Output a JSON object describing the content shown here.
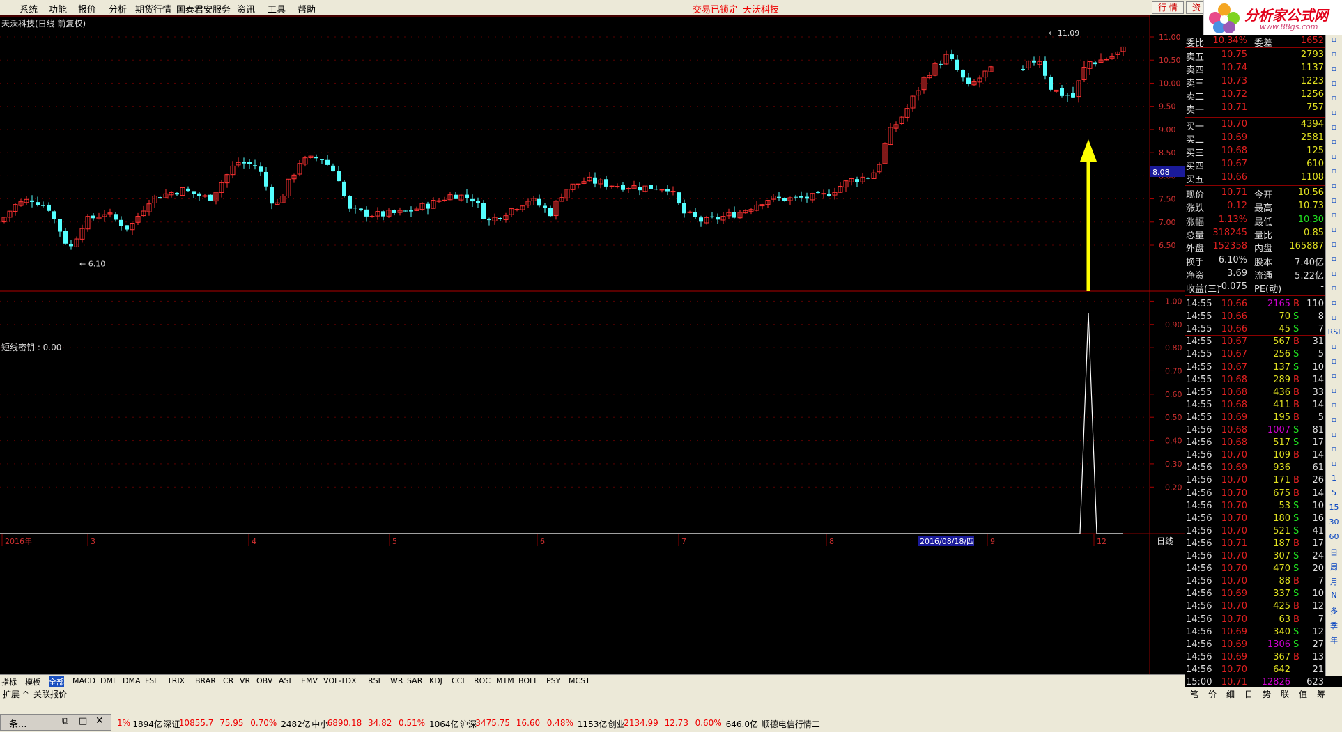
{
  "menu": {
    "items": [
      "系统",
      "功能",
      "报价",
      "分析",
      "期货行情",
      "国泰君安服务",
      "资讯",
      "工具",
      "帮助"
    ],
    "center": [
      "交易已锁定",
      "天沃科技"
    ],
    "right": [
      "行 情",
      "资"
    ]
  },
  "logo": {
    "name": "分析家公式网",
    "url": "www.88gs.com"
  },
  "chart": {
    "title": "天沃科技(日线 前复权)",
    "indicator_title": "短线密钥 : 0.00",
    "price_ticks": [
      "11.00",
      "10.50",
      "10.00",
      "9.50",
      "9.00",
      "8.50",
      "8.00",
      "7.50",
      "7.00",
      "6.50"
    ],
    "current_price_label": "8.08",
    "ind_ticks": [
      "1.00",
      "0.90",
      "0.80",
      "0.70",
      "0.60",
      "0.50",
      "0.40",
      "0.30",
      "0.20"
    ],
    "max_label": "11.09",
    "min_label": "6.10",
    "date_labels": [
      "2016年",
      "3",
      "4",
      "5",
      "6",
      "7",
      "8",
      "9",
      "12"
    ],
    "date_highlight": "2016/08/18/四",
    "period": "日线",
    "colors": {
      "up": "#ff3232",
      "down": "#54ffff",
      "arrow": "#ffff00",
      "grid": "#8b0000"
    }
  },
  "indicator_tabs": [
    "指标",
    "模板",
    "全部",
    "MACD",
    "DMI",
    "DMA",
    "FSL",
    "TRIX",
    "BRAR",
    "CR",
    "VR",
    "OBV",
    "ASI",
    "EMV",
    "VOL-TDX",
    "RSI",
    "WR",
    "SAR",
    "KDJ",
    "CCI",
    "ROC",
    "MTM",
    "BOLL",
    "PSY",
    "MCST"
  ],
  "bottom_tabs": [
    "扩展 ^",
    "关联报价"
  ],
  "quote": {
    "header": [
      {
        "l": "委比",
        "v": "10.34%",
        "l2": "委差",
        "v2": "1652"
      }
    ],
    "sell": [
      [
        "卖五",
        "10.75",
        "2793"
      ],
      [
        "卖四",
        "10.74",
        "1137"
      ],
      [
        "卖三",
        "10.73",
        "1223"
      ],
      [
        "卖二",
        "10.72",
        "1256"
      ],
      [
        "卖一",
        "10.71",
        "757"
      ]
    ],
    "buy": [
      [
        "买一",
        "10.70",
        "4394"
      ],
      [
        "买二",
        "10.69",
        "2581"
      ],
      [
        "买三",
        "10.68",
        "125"
      ],
      [
        "买四",
        "10.67",
        "610"
      ],
      [
        "买五",
        "10.66",
        "1108"
      ]
    ],
    "stats": [
      [
        "现价",
        "10.71",
        "今开",
        "10.56"
      ],
      [
        "涨跌",
        "0.12",
        "最高",
        "10.73"
      ],
      [
        "涨幅",
        "1.13%",
        "最低",
        "10.30"
      ],
      [
        "总量",
        "318245",
        "量比",
        "0.85"
      ],
      [
        "外盘",
        "152358",
        "内盘",
        "165887"
      ],
      [
        "换手",
        "6.10%",
        "股本",
        "7.40亿"
      ],
      [
        "净资",
        "3.69",
        "流通",
        "5.22亿"
      ],
      [
        "收益(三)",
        "-0.075",
        "PE(动)",
        "-"
      ]
    ],
    "ticks": [
      [
        "14:55",
        "10.66",
        "2165",
        "B",
        "110"
      ],
      [
        "14:55",
        "10.66",
        "70",
        "S",
        "8"
      ],
      [
        "14:55",
        "10.66",
        "45",
        "S",
        "7"
      ],
      [
        "14:55",
        "10.67",
        "567",
        "B",
        "31"
      ],
      [
        "14:55",
        "10.67",
        "256",
        "S",
        "5"
      ],
      [
        "14:55",
        "10.67",
        "137",
        "S",
        "10"
      ],
      [
        "14:55",
        "10.68",
        "289",
        "B",
        "14"
      ],
      [
        "14:55",
        "10.68",
        "436",
        "B",
        "33"
      ],
      [
        "14:55",
        "10.68",
        "411",
        "B",
        "14"
      ],
      [
        "14:55",
        "10.69",
        "195",
        "B",
        "5"
      ],
      [
        "14:56",
        "10.68",
        "1007",
        "S",
        "81"
      ],
      [
        "14:56",
        "10.68",
        "517",
        "S",
        "17"
      ],
      [
        "14:56",
        "10.70",
        "109",
        "B",
        "14"
      ],
      [
        "14:56",
        "10.69",
        "936",
        "",
        "61"
      ],
      [
        "14:56",
        "10.70",
        "171",
        "B",
        "26"
      ],
      [
        "14:56",
        "10.70",
        "675",
        "B",
        "14"
      ],
      [
        "14:56",
        "10.70",
        "53",
        "S",
        "10"
      ],
      [
        "14:56",
        "10.70",
        "180",
        "S",
        "16"
      ],
      [
        "14:56",
        "10.70",
        "521",
        "S",
        "41"
      ],
      [
        "14:56",
        "10.71",
        "187",
        "B",
        "17"
      ],
      [
        "14:56",
        "10.70",
        "307",
        "S",
        "24"
      ],
      [
        "14:56",
        "10.70",
        "470",
        "S",
        "20"
      ],
      [
        "14:56",
        "10.70",
        "88",
        "B",
        "7"
      ],
      [
        "14:56",
        "10.69",
        "337",
        "S",
        "10"
      ],
      [
        "14:56",
        "10.70",
        "425",
        "B",
        "12"
      ],
      [
        "14:56",
        "10.70",
        "63",
        "B",
        "7"
      ],
      [
        "14:56",
        "10.69",
        "340",
        "S",
        "12"
      ],
      [
        "14:56",
        "10.69",
        "1306",
        "S",
        "27"
      ],
      [
        "14:56",
        "10.69",
        "367",
        "B",
        "13"
      ],
      [
        "14:56",
        "10.70",
        "642",
        "",
        "21"
      ],
      [
        "15:00",
        "10.71",
        "12826",
        "",
        "623"
      ]
    ],
    "tabs": [
      "笔",
      "价",
      "细",
      "日",
      "势",
      "联",
      "值",
      "筹"
    ]
  },
  "rightbar": [
    "",
    "",
    "",
    "",
    "",
    "",
    "",
    "",
    "",
    "",
    "",
    "",
    "",
    "",
    "",
    "",
    "",
    "",
    "",
    "",
    "RSI",
    "",
    "",
    "",
    "",
    "",
    "",
    "",
    "",
    "",
    "1",
    "5",
    "15",
    "30",
    "60",
    "日",
    "周",
    "月",
    "N",
    "多",
    "季",
    "年"
  ],
  "status": {
    "winlabel": "条...",
    "items": [
      {
        "t": "1%",
        "c": "#e00"
      },
      {
        "t": "1894亿",
        "c": "#000"
      },
      {
        "t": "深证",
        "c": "#000"
      },
      {
        "t": "10855.7",
        "c": "#e00"
      },
      {
        "t": "75.95",
        "c": "#e00"
      },
      {
        "t": "0.70%",
        "c": "#e00"
      },
      {
        "t": "2482亿",
        "c": "#000"
      },
      {
        "t": "中小",
        "c": "#000"
      },
      {
        "t": "6890.18",
        "c": "#e00"
      },
      {
        "t": "34.82",
        "c": "#e00"
      },
      {
        "t": "0.51%",
        "c": "#e00"
      },
      {
        "t": "1064亿",
        "c": "#000"
      },
      {
        "t": "沪深",
        "c": "#000"
      },
      {
        "t": "3475.75",
        "c": "#e00"
      },
      {
        "t": "16.60",
        "c": "#e00"
      },
      {
        "t": "0.48%",
        "c": "#e00"
      },
      {
        "t": "1153亿",
        "c": "#000"
      },
      {
        "t": "创业",
        "c": "#000"
      },
      {
        "t": "2134.99",
        "c": "#e00"
      },
      {
        "t": "12.73",
        "c": "#e00"
      },
      {
        "t": "0.60%",
        "c": "#e00"
      },
      {
        "t": "646.0亿",
        "c": "#000"
      },
      {
        "t": "顺德电信行情二",
        "c": "#000"
      }
    ]
  }
}
